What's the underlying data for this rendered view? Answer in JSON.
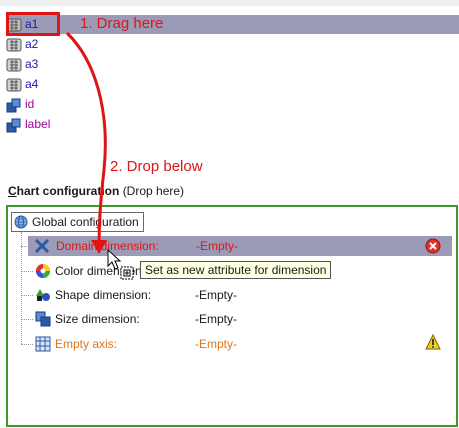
{
  "attributes": [
    {
      "label": "a1",
      "icon": "nominal-attribute-icon",
      "selected": true
    },
    {
      "label": "a2",
      "icon": "nominal-attribute-icon"
    },
    {
      "label": "a3",
      "icon": "nominal-attribute-icon"
    },
    {
      "label": "a4",
      "icon": "nominal-attribute-icon"
    },
    {
      "label": "id",
      "icon": "special-attribute-icon"
    },
    {
      "label": "label",
      "icon": "special-attribute-icon"
    }
  ],
  "annotations": {
    "drag": "1. Drag here",
    "drop": "2. Drop below"
  },
  "config_section": {
    "title_prefix": "C",
    "title_rest": "hart configuration",
    "hint": "(Drop here)"
  },
  "global_config": {
    "label": "Global configuration",
    "icon": "globe-icon"
  },
  "dimensions": [
    {
      "name": "Domain dimension:",
      "value": "-Empty-",
      "icon": "domain-dimension-icon",
      "status": "error-icon",
      "highlighted": true
    },
    {
      "name": "Color dimension:",
      "value": "",
      "icon": "color-wheel-icon"
    },
    {
      "name": "Shape dimension:",
      "value": "-Empty-",
      "icon": "shapes-icon"
    },
    {
      "name": "Size dimension:",
      "value": "-Empty-",
      "icon": "size-icon"
    },
    {
      "name": "Empty axis:",
      "value": "-Empty-",
      "icon": "axis-grid-icon",
      "status": "warning-icon"
    }
  ],
  "tooltip": "Set as new attribute for dimension",
  "colors": {
    "selection": "#9b9bb8",
    "annotation_red": "#e01414",
    "panel_border": "#3c9a28",
    "warning_orange": "#e0741a"
  }
}
